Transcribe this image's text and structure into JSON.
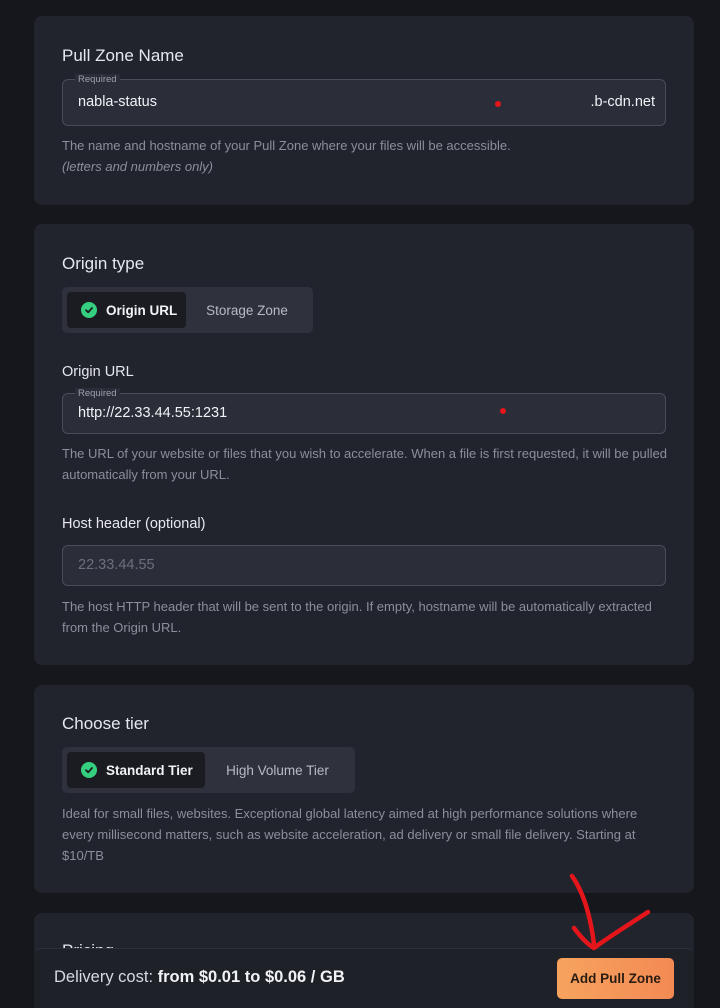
{
  "pull_zone": {
    "title": "Pull Zone Name",
    "required_label": "Required",
    "name_value": "nabla-status",
    "suffix": ".b-cdn.net",
    "help_text": "The name and hostname of your Pull Zone where your files will be accessible.",
    "help_note": "(letters and numbers only)"
  },
  "origin": {
    "title": "Origin type",
    "tabs": [
      {
        "label": "Origin URL",
        "active": true
      },
      {
        "label": "Storage Zone",
        "active": false
      }
    ],
    "url_label": "Origin URL",
    "required_label": "Required",
    "url_value": "http://22.33.44.55:1231",
    "url_help": "The URL of your website or files that you wish to accelerate. When a file is first requested, it will be pulled automatically from your URL.",
    "host_label": "Host header (optional)",
    "host_placeholder": "22.33.44.55",
    "host_help": "The host HTTP header that will be sent to the origin. If empty, hostname will be automatically extracted from the Origin URL."
  },
  "tier": {
    "title": "Choose tier",
    "tabs": [
      {
        "label": "Standard Tier",
        "active": true
      },
      {
        "label": "High Volume Tier",
        "active": false
      }
    ],
    "help": "Ideal for small files, websites. Exceptional global latency aimed at high performance solutions where every millisecond matters, such as website acceleration, ad delivery or small file delivery. Starting at $10/TB"
  },
  "pricing": {
    "title": "Pricing"
  },
  "footer": {
    "delivery_label": "Delivery cost:",
    "delivery_from": "from $0.01",
    "delivery_to_word": "to",
    "delivery_to": "$0.06 / GB",
    "add_button": "Add Pull Zone"
  },
  "colors": {
    "background": "#16171d",
    "card": "#22242d",
    "accent_check": "#35d07f",
    "button_gradient_start": "#f6a35e",
    "button_gradient_end": "#f38a54",
    "annotation_red": "#e4151b"
  }
}
